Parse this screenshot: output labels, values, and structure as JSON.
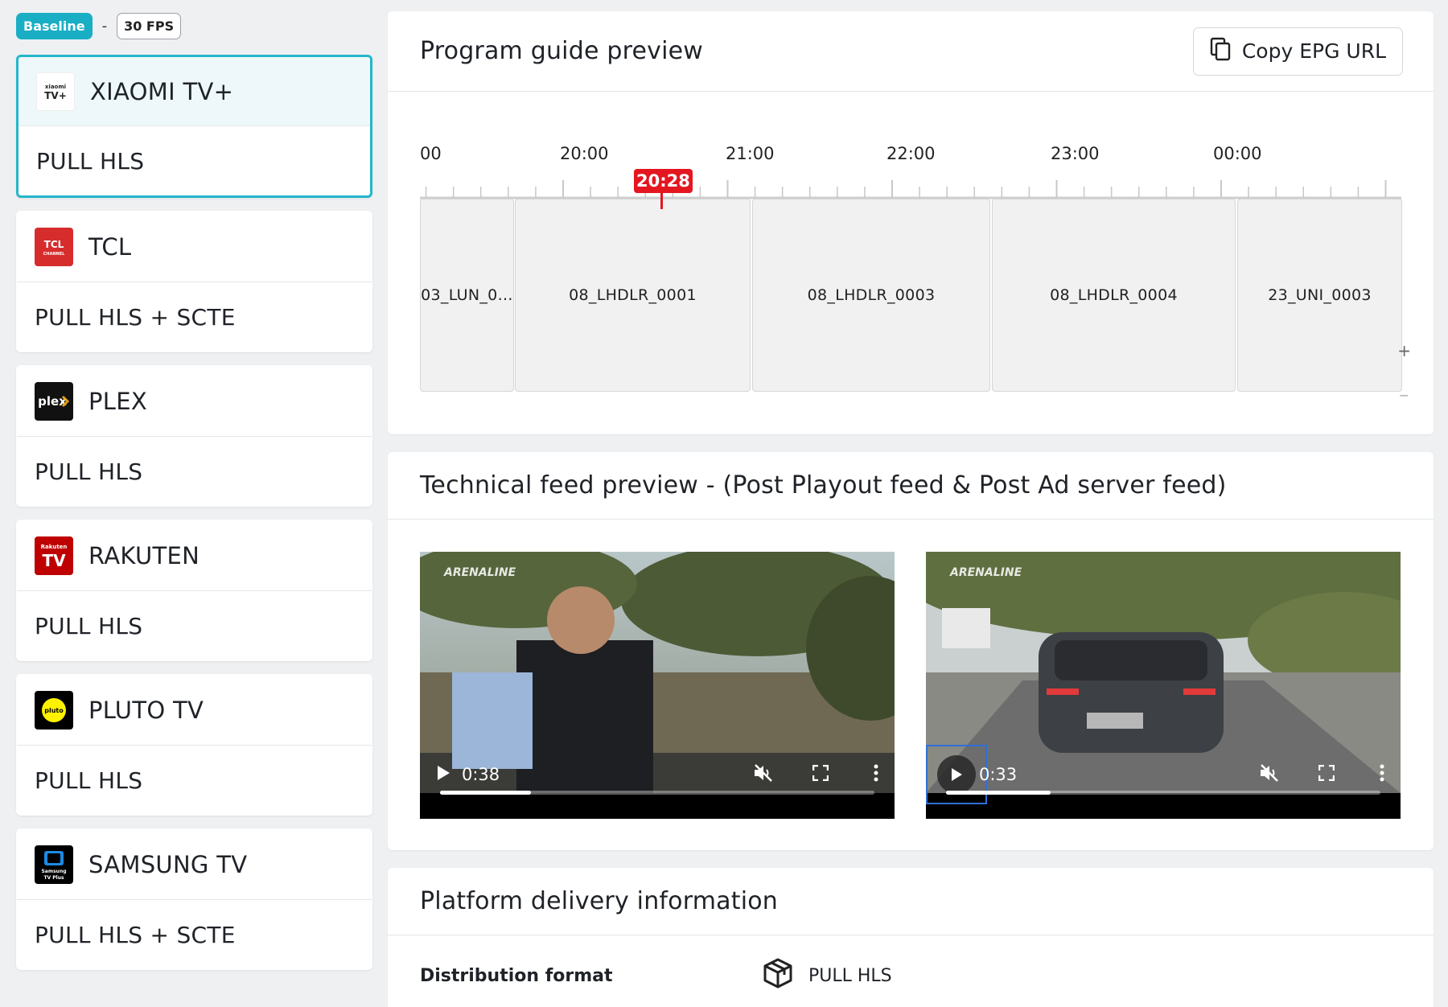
{
  "top": {
    "baseline": "Baseline",
    "separator": "-",
    "fps": "30 FPS"
  },
  "platforms": [
    {
      "name": "XIAOMI TV+",
      "delivery": "PULL HLS",
      "logo_text": "xiaomi TV+",
      "logo_color": "#ffffff",
      "selected": true
    },
    {
      "name": "TCL",
      "delivery": "PULL HLS + SCTE",
      "logo_text": "TCL",
      "logo_color": "#d62c2c"
    },
    {
      "name": "PLEX",
      "delivery": "PULL HLS",
      "logo_text": "plex",
      "logo_color": "#111111"
    },
    {
      "name": "RAKUTEN",
      "delivery": "PULL HLS",
      "logo_text": "TV",
      "logo_color": "#bf0000"
    },
    {
      "name": "PLUTO TV",
      "delivery": "PULL HLS",
      "logo_text": "pluto tv",
      "logo_color": "#000000"
    },
    {
      "name": "SAMSUNG TV",
      "delivery": "PULL HLS + SCTE",
      "logo_text": "Samsung TV Plus",
      "logo_color": "#000000"
    }
  ],
  "epg": {
    "title": "Program guide preview",
    "copy_button": "Copy EPG URL",
    "ticks": [
      "00",
      "20:00",
      "21:00",
      "22:00",
      "23:00",
      "00:00"
    ],
    "now": "20:28",
    "programs": [
      "03_LUN_0…",
      "08_LHDLR_0001",
      "08_LHDLR_0003",
      "08_LHDLR_0004",
      "23_UNI_0003"
    ],
    "zoom_in": "+",
    "zoom_out": "−"
  },
  "feed": {
    "title": "Technical feed preview - (Post Playout feed & Post Ad server feed)",
    "videos": [
      {
        "time": "0:38",
        "progress": 0.21
      },
      {
        "time": "0:33",
        "progress": 0.24
      }
    ],
    "watermark": "ARENALINE"
  },
  "delivery": {
    "title": "Platform delivery information",
    "label": "Distribution format",
    "value": "PULL HLS"
  },
  "colors": {
    "accent": "#25b6cc",
    "now": "#e4161f"
  }
}
